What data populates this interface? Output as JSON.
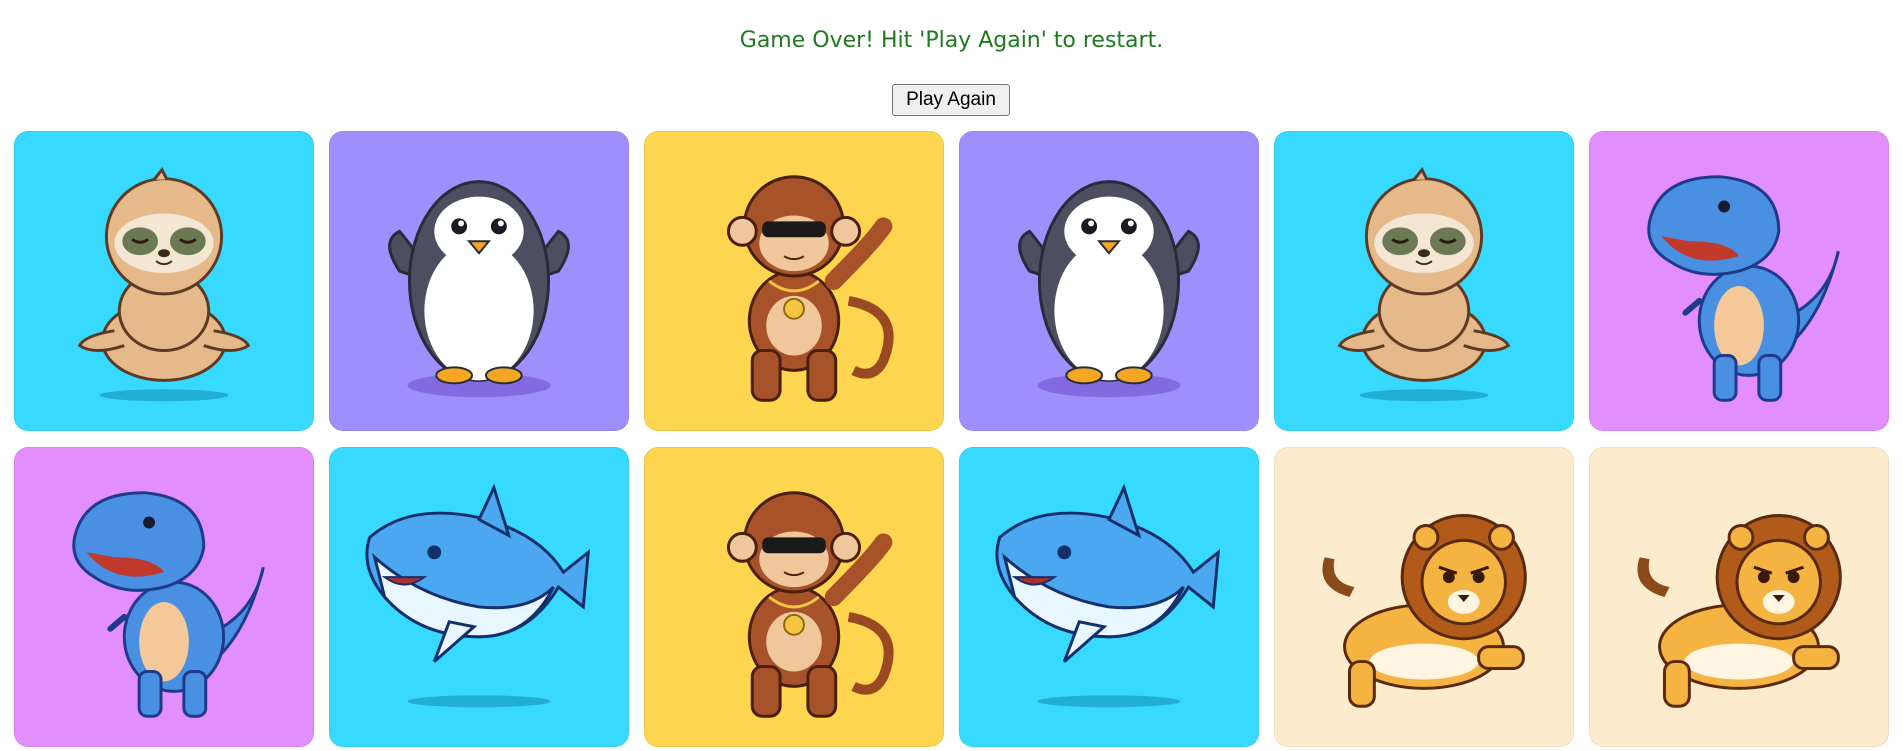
{
  "status_message": "Game Over! Hit 'Play Again' to restart.",
  "play_again_label": "Play Again",
  "colors": {
    "status": "#1f7a1f",
    "cyan": "#38d9fe",
    "purple": "#9e8ffd",
    "yellow": "#fdd54f",
    "pink": "#e28ffd",
    "cream": "#fdebce"
  },
  "cards": [
    {
      "animal": "sloth-icon",
      "bg": "#38d9fe"
    },
    {
      "animal": "penguin-icon",
      "bg": "#9e8ffd"
    },
    {
      "animal": "monkey-icon",
      "bg": "#fdd54f"
    },
    {
      "animal": "penguin-icon",
      "bg": "#9e8ffd"
    },
    {
      "animal": "sloth-icon",
      "bg": "#38d9fe"
    },
    {
      "animal": "dinosaur-icon",
      "bg": "#e28ffd"
    },
    {
      "animal": "dinosaur-icon",
      "bg": "#e28ffd"
    },
    {
      "animal": "shark-icon",
      "bg": "#38d9fe"
    },
    {
      "animal": "monkey-icon",
      "bg": "#fdd54f"
    },
    {
      "animal": "shark-icon",
      "bg": "#38d9fe"
    },
    {
      "animal": "lion-icon",
      "bg": "#fdebce"
    },
    {
      "animal": "lion-icon",
      "bg": "#fdebce"
    }
  ]
}
